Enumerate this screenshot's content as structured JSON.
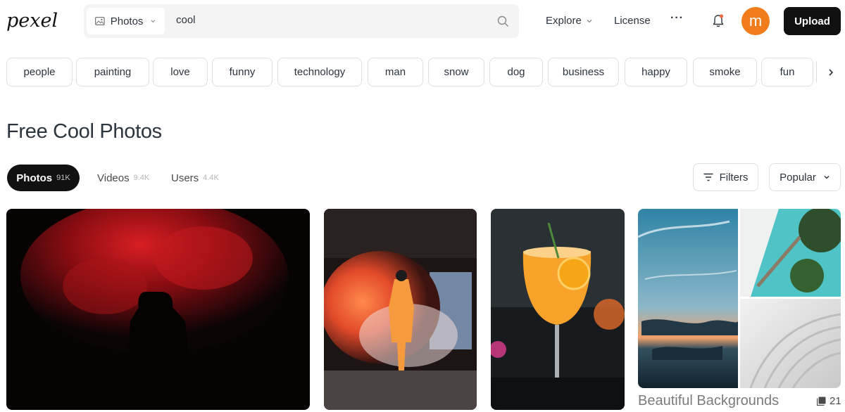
{
  "header": {
    "logo_text": "pexels",
    "search": {
      "type_label": "Photos",
      "value": "cool"
    },
    "nav": {
      "explore": "Explore",
      "license": "License",
      "more": "···"
    },
    "avatar_initial": "m",
    "upload_label": "Upload",
    "colors": {
      "avatar": "#f07c1b",
      "upload_bg": "#111111"
    }
  },
  "chips": [
    "people",
    "painting",
    "love",
    "funny",
    "technology",
    "man",
    "snow",
    "dog",
    "business",
    "happy",
    "smoke",
    "fun"
  ],
  "page_title": "Free Cool Photos",
  "tabs": [
    {
      "label": "Photos",
      "count": "91K",
      "active": true
    },
    {
      "label": "Videos",
      "count": "9.4K",
      "active": false
    },
    {
      "label": "Users",
      "count": "4.4K",
      "active": false
    }
  ],
  "filters_label": "Filters",
  "sort_label": "Popular",
  "collection": {
    "title": "Beautiful Backgrounds",
    "count": "21"
  }
}
